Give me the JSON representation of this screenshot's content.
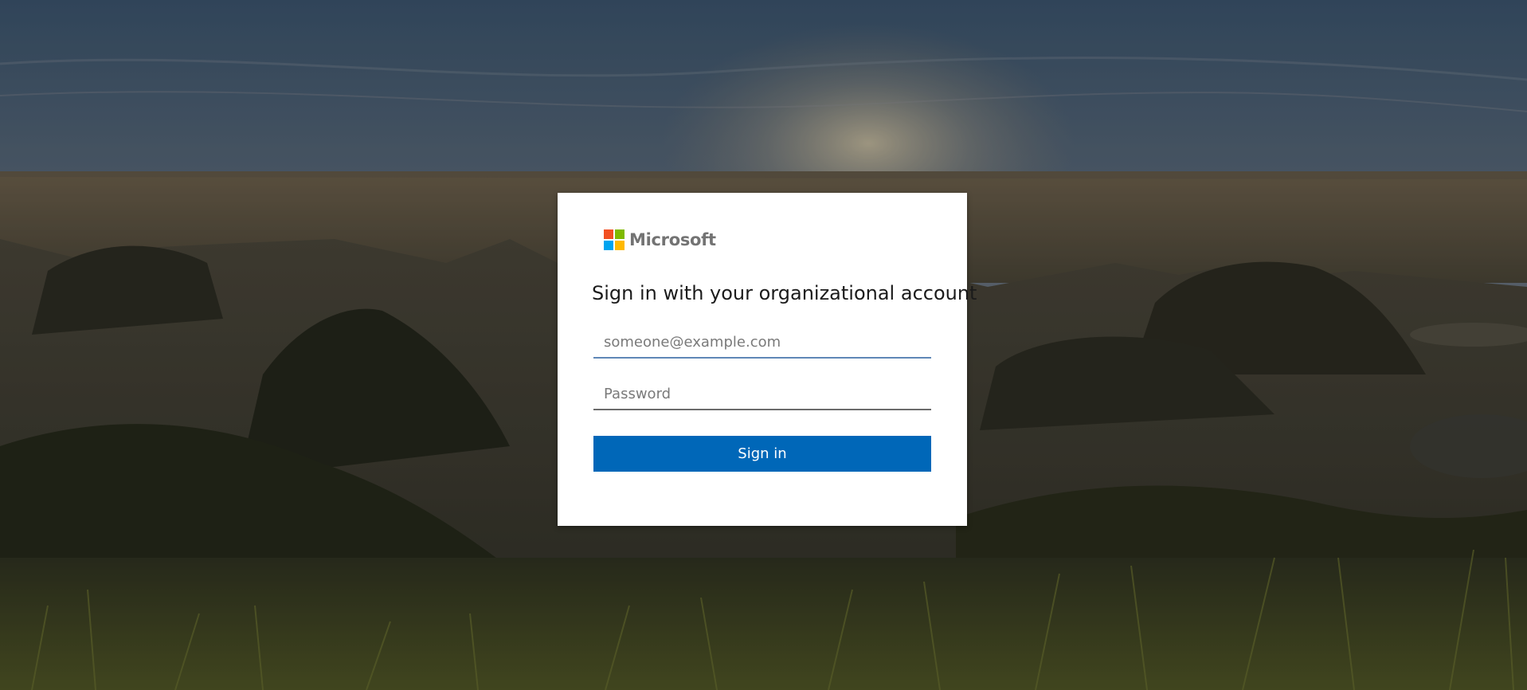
{
  "page": {
    "background_description_colors": {
      "sky_top": "#3c556e",
      "sky_horizon": "#8a7b63",
      "ground": "#2b2d21",
      "grass": "#4d5322"
    }
  },
  "brand": {
    "name": "Microsoft",
    "logo_icon": "microsoft-logo-icon",
    "logo_colors": [
      "#f25022",
      "#7fba00",
      "#00a4ef",
      "#ffb900"
    ]
  },
  "signin": {
    "heading": "Sign in with your organizational account",
    "email_placeholder": "someone@example.com",
    "email_value": "",
    "password_placeholder": "Password",
    "password_value": "",
    "button_label": "Sign in",
    "button_color": "#0067b8"
  }
}
